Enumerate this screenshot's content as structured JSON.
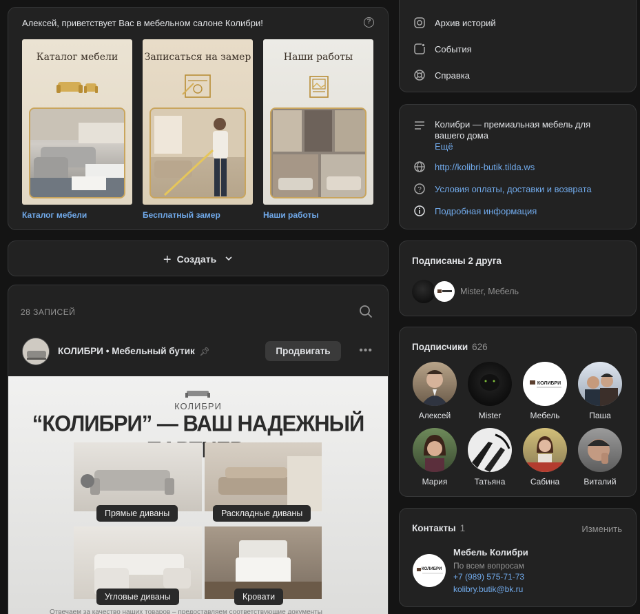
{
  "welcome": {
    "title": "Алексей, приветствует Вас в мебельном салоне Колибри!",
    "help": "?",
    "tiles": [
      {
        "title": "Каталог мебели",
        "caption": "Каталог мебели"
      },
      {
        "title": "Записаться на замер",
        "caption": "Бесплатный замер"
      },
      {
        "title": "Наши работы",
        "caption": "Наши работы"
      }
    ]
  },
  "create": {
    "label": "Создать"
  },
  "feed": {
    "count_label": "28 ЗАПИСЕЙ",
    "post": {
      "author": "КОЛИБРИ • Мебельный бутик",
      "promote_label": "Продвигать",
      "more": "•••",
      "image": {
        "brand": "КОЛИБРИ",
        "headline": "“КОЛИБРИ” — ВАШ НАДЕЖНЫЙ ПАРТНЕР:",
        "panels": [
          "Прямые диваны",
          "Раскладные диваны",
          "Угловые диваны",
          "Кровати"
        ],
        "footer": "Отвечаем за качество наших товаров – предоставляем соответствующие документы"
      }
    }
  },
  "menu": {
    "items": [
      {
        "label": "Архив историй",
        "icon": "instagram-icon"
      },
      {
        "label": "События",
        "icon": "calendar-icon"
      },
      {
        "label": "Справка",
        "icon": "help-ring-icon"
      }
    ]
  },
  "info": {
    "description": "Колибри — премиальная мебель для вашего дома",
    "more_label": "Ещё",
    "website": "http://kolibri-butik.tilda.ws",
    "terms": "Условия оплаты, доставки и возврата",
    "details": "Подробная информация"
  },
  "friends": {
    "title": "Подписаны 2 друга",
    "names": "Mister, Мебель"
  },
  "subscribers": {
    "title": "Подписчики",
    "count": "626",
    "people": [
      {
        "name": "Алексей"
      },
      {
        "name": "Mister"
      },
      {
        "name": "Мебель"
      },
      {
        "name": "Паша"
      },
      {
        "name": "Мария"
      },
      {
        "name": "Татьяна"
      },
      {
        "name": "Сабина"
      },
      {
        "name": "Виталий"
      }
    ]
  },
  "contacts": {
    "title": "Контакты",
    "count": "1",
    "edit_label": "Изменить",
    "name": "Мебель Колибри",
    "role": "По всем вопросам",
    "phone": "+7 (989) 575-71-73",
    "email": "kolibry.butik@bk.ru",
    "logo_text": "КОЛИБРИ"
  },
  "colors": {
    "link": "#71aaeb",
    "card": "#222222",
    "background": "#141414",
    "accent_gold": "#c9a55d"
  }
}
